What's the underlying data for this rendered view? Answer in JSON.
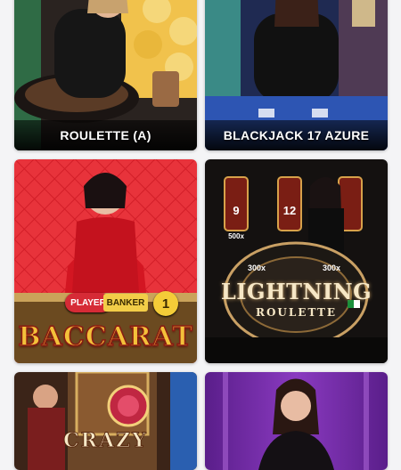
{
  "games": [
    {
      "id": "roulette-a",
      "label": "ROULETTE (A)"
    },
    {
      "id": "blackjack-17-azure",
      "label": "BLACKJACK 17 AZURE"
    },
    {
      "id": "baccarat",
      "label": "BACCARAT",
      "badges": {
        "player": "PLAYER",
        "banker": "BANKER",
        "number": "1"
      }
    },
    {
      "id": "lightning-roulette",
      "label": "LIGHTNING",
      "sublabel": "ROULETTE",
      "multipliers": [
        "500x",
        "9",
        "12",
        "300x",
        "300x"
      ]
    },
    {
      "id": "crazy-time",
      "label": "CRAZY"
    },
    {
      "id": "live-dealer-purple",
      "label": ""
    }
  ]
}
